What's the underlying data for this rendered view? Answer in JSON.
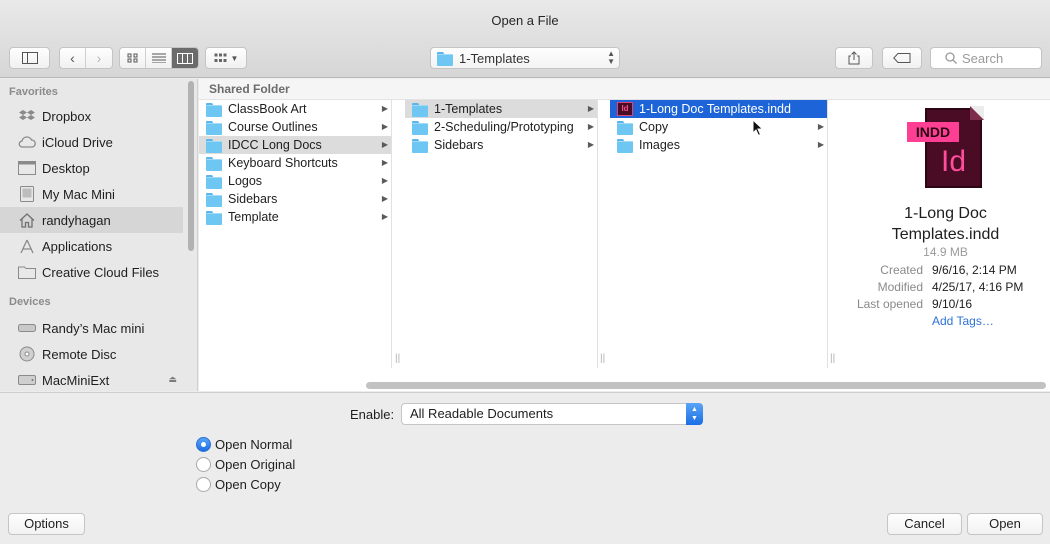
{
  "window": {
    "title": "Open a File"
  },
  "toolbar": {
    "path_popup": "1-Templates",
    "search_placeholder": "Search"
  },
  "sidebar": {
    "favorites_header": "Favorites",
    "favorites": [
      {
        "label": "Dropbox",
        "icon": "dropbox-icon"
      },
      {
        "label": "iCloud Drive",
        "icon": "cloud-icon"
      },
      {
        "label": "Desktop",
        "icon": "desktop-icon"
      },
      {
        "label": "My Mac Mini",
        "icon": "computer-icon"
      },
      {
        "label": "randyhagan",
        "icon": "home-icon",
        "selected": true
      },
      {
        "label": "Applications",
        "icon": "applications-icon"
      },
      {
        "label": "Creative Cloud Files",
        "icon": "folder-icon"
      }
    ],
    "devices_header": "Devices",
    "devices": [
      {
        "label": "Randy’s Mac mini",
        "icon": "mac-mini-icon"
      },
      {
        "label": "Remote Disc",
        "icon": "disc-icon"
      },
      {
        "label": "MacMiniExt",
        "icon": "drive-icon",
        "eject": true
      }
    ]
  },
  "browser": {
    "header": "Shared Folder",
    "columns": [
      {
        "items": [
          {
            "label": "ClassBook Art",
            "has_children": true
          },
          {
            "label": "Course Outlines",
            "has_children": true
          },
          {
            "label": "IDCC Long Docs",
            "has_children": true,
            "state": "gray"
          },
          {
            "label": "Keyboard Shortcuts",
            "has_children": true
          },
          {
            "label": "Logos",
            "has_children": true
          },
          {
            "label": "Sidebars",
            "has_children": true
          },
          {
            "label": "Template",
            "has_children": true
          }
        ]
      },
      {
        "items": [
          {
            "label": "1-Templates",
            "has_children": true,
            "state": "gray"
          },
          {
            "label": "2-Scheduling/Prototyping",
            "has_children": true
          },
          {
            "label": "Sidebars",
            "has_children": true
          }
        ]
      },
      {
        "items": [
          {
            "label": "1-Long Doc Templates.indd",
            "kind": "indd",
            "state": "blue"
          },
          {
            "label": "Copy",
            "has_children": true
          },
          {
            "label": "Images",
            "has_children": true
          }
        ]
      }
    ]
  },
  "preview": {
    "badge": "INDD",
    "glyph": "Id",
    "name_line1": "1-Long Doc",
    "name_line2": "Templates.indd",
    "size": "14.9 MB",
    "created_label": "Created",
    "created": "9/6/16, 2:14 PM",
    "modified_label": "Modified",
    "modified": "4/25/17, 4:16 PM",
    "last_opened_label": "Last opened",
    "last_opened": "9/10/16",
    "add_tags": "Add Tags…"
  },
  "options": {
    "enable_label": "Enable:",
    "enable_value": "All Readable Documents",
    "open_modes": [
      {
        "label": "Open Normal",
        "checked": true
      },
      {
        "label": "Open Original",
        "checked": false
      },
      {
        "label": "Open Copy",
        "checked": false
      }
    ]
  },
  "footer": {
    "options_button": "Options",
    "cancel_button": "Cancel",
    "open_button": "Open"
  }
}
